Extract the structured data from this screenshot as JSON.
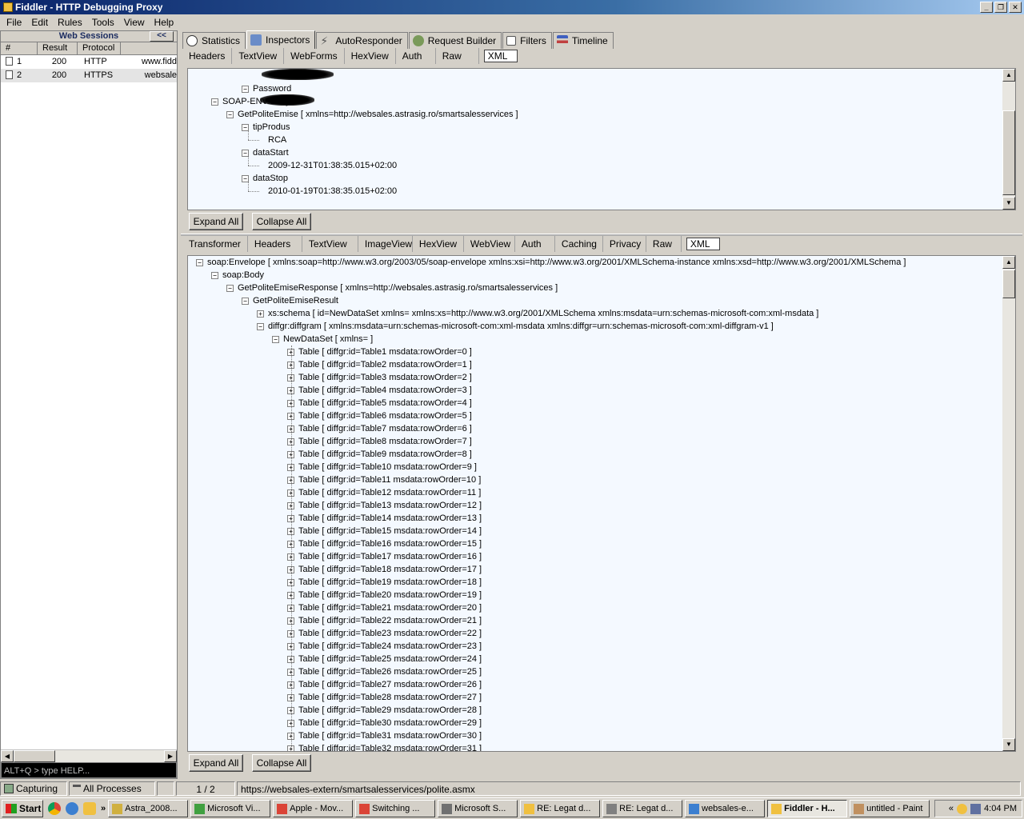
{
  "window": {
    "title": "Fiddler - HTTP Debugging Proxy"
  },
  "menu": [
    "File",
    "Edit",
    "Rules",
    "Tools",
    "View",
    "Help"
  ],
  "left": {
    "header": "Web Sessions",
    "collapse_label": "<<",
    "columns": [
      "#",
      "Result",
      "Protocol"
    ],
    "sessions": [
      {
        "num": "1",
        "result": "200",
        "protocol": "HTTP",
        "host": "www.fidd"
      },
      {
        "num": "2",
        "result": "200",
        "protocol": "HTTPS",
        "host": "websale"
      }
    ],
    "quickexec_placeholder": "ALT+Q > type HELP..."
  },
  "tabs": [
    "Statistics",
    "Inspectors",
    "AutoResponder",
    "Request Builder",
    "Filters",
    "Timeline"
  ],
  "request_tabs": [
    "Headers",
    "TextView",
    "WebForms",
    "HexView",
    "Auth",
    "Raw",
    "XML"
  ],
  "response_tabs": [
    "Transformer",
    "Headers",
    "TextView",
    "ImageView",
    "HexView",
    "WebView",
    "Auth",
    "Caching",
    "Privacy",
    "Raw",
    "XML"
  ],
  "request_tree": [
    {
      "text": "Password",
      "depth": 3
    },
    {
      "text": "SOAP-ENV:Body",
      "depth": 1
    },
    {
      "text": "GetPoliteEmise [ xmlns=http://websales.astrasig.ro/smartsalesservices ]",
      "depth": 2
    },
    {
      "text": "tipProdus",
      "depth": 3
    },
    {
      "text": "RCA",
      "depth": 4
    },
    {
      "text": "dataStart",
      "depth": 3
    },
    {
      "text": "2009-12-31T01:38:35.015+02:00",
      "depth": 4
    },
    {
      "text": "dataStop",
      "depth": 3
    },
    {
      "text": "2010-01-19T01:38:35.015+02:00",
      "depth": 4
    }
  ],
  "buttons": {
    "expand_all": "Expand All",
    "collapse_all": "Collapse All"
  },
  "response_tree": [
    {
      "text": "soap:Envelope [ xmlns:soap=http://www.w3.org/2003/05/soap-envelope xmlns:xsi=http://www.w3.org/2001/XMLSchema-instance xmlns:xsd=http://www.w3.org/2001/XMLSchema ]",
      "depth": 0,
      "box": "-"
    },
    {
      "text": "soap:Body",
      "depth": 1,
      "box": "-"
    },
    {
      "text": "GetPoliteEmiseResponse [ xmlns=http://websales.astrasig.ro/smartsalesservices ]",
      "depth": 2,
      "box": "-"
    },
    {
      "text": "GetPoliteEmiseResult",
      "depth": 3,
      "box": "-"
    },
    {
      "text": "xs:schema [ id=NewDataSet xmlns= xmlns:xs=http://www.w3.org/2001/XMLSchema xmlns:msdata=urn:schemas-microsoft-com:xml-msdata ]",
      "depth": 4,
      "box": "+"
    },
    {
      "text": "diffgr:diffgram [ xmlns:msdata=urn:schemas-microsoft-com:xml-msdata xmlns:diffgr=urn:schemas-microsoft-com:xml-diffgram-v1 ]",
      "depth": 4,
      "box": "-"
    },
    {
      "text": "NewDataSet [ xmlns= ]",
      "depth": 5,
      "box": "-"
    },
    {
      "text": "Table [ diffgr:id=Table1 msdata:rowOrder=0 ]",
      "depth": 6,
      "box": "+"
    },
    {
      "text": "Table [ diffgr:id=Table2 msdata:rowOrder=1 ]",
      "depth": 6,
      "box": "+"
    },
    {
      "text": "Table [ diffgr:id=Table3 msdata:rowOrder=2 ]",
      "depth": 6,
      "box": "+"
    },
    {
      "text": "Table [ diffgr:id=Table4 msdata:rowOrder=3 ]",
      "depth": 6,
      "box": "+"
    },
    {
      "text": "Table [ diffgr:id=Table5 msdata:rowOrder=4 ]",
      "depth": 6,
      "box": "+"
    },
    {
      "text": "Table [ diffgr:id=Table6 msdata:rowOrder=5 ]",
      "depth": 6,
      "box": "+"
    },
    {
      "text": "Table [ diffgr:id=Table7 msdata:rowOrder=6 ]",
      "depth": 6,
      "box": "+"
    },
    {
      "text": "Table [ diffgr:id=Table8 msdata:rowOrder=7 ]",
      "depth": 6,
      "box": "+"
    },
    {
      "text": "Table [ diffgr:id=Table9 msdata:rowOrder=8 ]",
      "depth": 6,
      "box": "+"
    },
    {
      "text": "Table [ diffgr:id=Table10 msdata:rowOrder=9 ]",
      "depth": 6,
      "box": "+"
    },
    {
      "text": "Table [ diffgr:id=Table11 msdata:rowOrder=10 ]",
      "depth": 6,
      "box": "+"
    },
    {
      "text": "Table [ diffgr:id=Table12 msdata:rowOrder=11 ]",
      "depth": 6,
      "box": "+"
    },
    {
      "text": "Table [ diffgr:id=Table13 msdata:rowOrder=12 ]",
      "depth": 6,
      "box": "+"
    },
    {
      "text": "Table [ diffgr:id=Table14 msdata:rowOrder=13 ]",
      "depth": 6,
      "box": "+"
    },
    {
      "text": "Table [ diffgr:id=Table15 msdata:rowOrder=14 ]",
      "depth": 6,
      "box": "+"
    },
    {
      "text": "Table [ diffgr:id=Table16 msdata:rowOrder=15 ]",
      "depth": 6,
      "box": "+"
    },
    {
      "text": "Table [ diffgr:id=Table17 msdata:rowOrder=16 ]",
      "depth": 6,
      "box": "+"
    },
    {
      "text": "Table [ diffgr:id=Table18 msdata:rowOrder=17 ]",
      "depth": 6,
      "box": "+"
    },
    {
      "text": "Table [ diffgr:id=Table19 msdata:rowOrder=18 ]",
      "depth": 6,
      "box": "+"
    },
    {
      "text": "Table [ diffgr:id=Table20 msdata:rowOrder=19 ]",
      "depth": 6,
      "box": "+"
    },
    {
      "text": "Table [ diffgr:id=Table21 msdata:rowOrder=20 ]",
      "depth": 6,
      "box": "+"
    },
    {
      "text": "Table [ diffgr:id=Table22 msdata:rowOrder=21 ]",
      "depth": 6,
      "box": "+"
    },
    {
      "text": "Table [ diffgr:id=Table23 msdata:rowOrder=22 ]",
      "depth": 6,
      "box": "+"
    },
    {
      "text": "Table [ diffgr:id=Table24 msdata:rowOrder=23 ]",
      "depth": 6,
      "box": "+"
    },
    {
      "text": "Table [ diffgr:id=Table25 msdata:rowOrder=24 ]",
      "depth": 6,
      "box": "+"
    },
    {
      "text": "Table [ diffgr:id=Table26 msdata:rowOrder=25 ]",
      "depth": 6,
      "box": "+"
    },
    {
      "text": "Table [ diffgr:id=Table27 msdata:rowOrder=26 ]",
      "depth": 6,
      "box": "+"
    },
    {
      "text": "Table [ diffgr:id=Table28 msdata:rowOrder=27 ]",
      "depth": 6,
      "box": "+"
    },
    {
      "text": "Table [ diffgr:id=Table29 msdata:rowOrder=28 ]",
      "depth": 6,
      "box": "+"
    },
    {
      "text": "Table [ diffgr:id=Table30 msdata:rowOrder=29 ]",
      "depth": 6,
      "box": "+"
    },
    {
      "text": "Table [ diffgr:id=Table31 msdata:rowOrder=30 ]",
      "depth": 6,
      "box": "+"
    },
    {
      "text": "Table [ diffgr:id=Table32 msdata:rowOrder=31 ]",
      "depth": 6,
      "box": "+"
    }
  ],
  "status": {
    "capturing": "Capturing",
    "processes": "All Processes",
    "count": "1 / 2",
    "url": "https://websales-extern/smartsalesservices/polite.asmx"
  },
  "taskbar": {
    "start": "Start",
    "items": [
      "Astra_2008...",
      "Microsoft Vi...",
      "Apple - Mov...",
      "Switching ...",
      "Microsoft S...",
      "RE: Legat d...",
      "RE: Legat d...",
      "websales-e...",
      "Fiddler - H...",
      "untitled - Paint"
    ],
    "active_index": 8,
    "clock": "4:04 PM"
  },
  "colors": {
    "titlebar": "#0a246a",
    "tree_bg": "#f4f9ff",
    "taskbar": "#d4d0c8"
  }
}
